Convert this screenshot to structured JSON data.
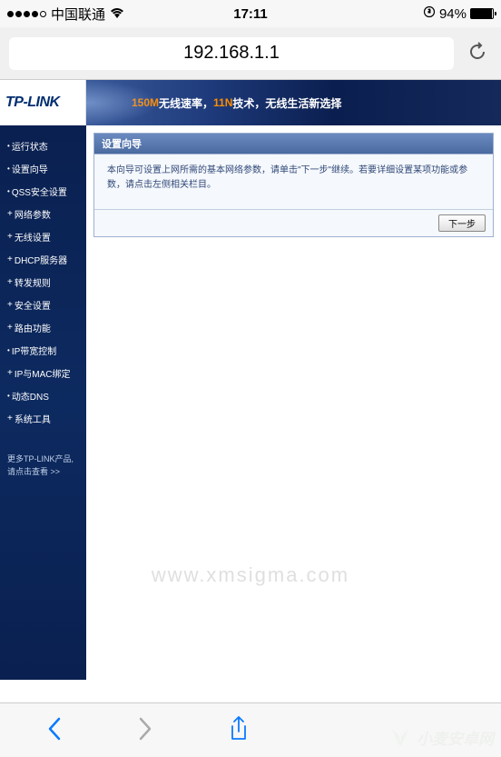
{
  "status": {
    "carrier": "中国联通",
    "time": "17:11",
    "battery": "94%"
  },
  "browser": {
    "url": "192.168.1.1"
  },
  "router": {
    "logo": "TP-LINK",
    "banner_orange": "150M",
    "banner_text1": "无线速率，",
    "banner_orange2": "11N",
    "banner_text2": "技术，无线生活新选择",
    "nav": [
      {
        "label": "运行状态",
        "plus": false
      },
      {
        "label": "设置向导",
        "plus": false
      },
      {
        "label": "QSS安全设置",
        "plus": false
      },
      {
        "label": "网络参数",
        "plus": true
      },
      {
        "label": "无线设置",
        "plus": true
      },
      {
        "label": "DHCP服务器",
        "plus": true
      },
      {
        "label": "转发规则",
        "plus": true
      },
      {
        "label": "安全设置",
        "plus": true
      },
      {
        "label": "路由功能",
        "plus": true
      },
      {
        "label": "IP带宽控制",
        "plus": false
      },
      {
        "label": "IP与MAC绑定",
        "plus": true
      },
      {
        "label": "动态DNS",
        "plus": false
      },
      {
        "label": "系统工具",
        "plus": true
      }
    ],
    "sidebar_foot1": "更多TP-LINK产品,",
    "sidebar_foot2": "请点击查看 >>",
    "panel": {
      "title": "设置向导",
      "body": "本向导可设置上网所需的基本网络参数，请单击\"下一步\"继续。若要详细设置某项功能或参数，请点击左侧相关栏目。",
      "next": "下一步"
    }
  },
  "watermark1": "www.xmsigma.com",
  "watermark2": "小麦安卓网"
}
